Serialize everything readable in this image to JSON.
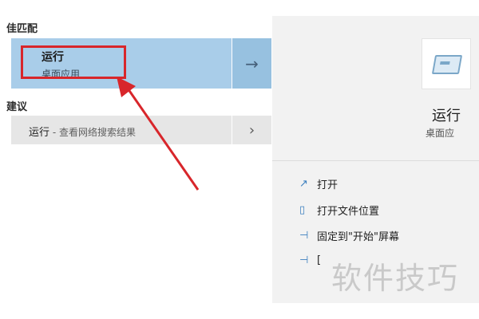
{
  "left": {
    "best_match_header": "佳匹配",
    "best_match": {
      "name": "运行",
      "type": "桌面应用",
      "open_arrow": "→"
    },
    "suggestions_header": "建议",
    "suggestion": {
      "text": "运行",
      "suffix": " - 查看网络搜索结果",
      "arrow": "›"
    }
  },
  "right": {
    "app_title": "运行",
    "app_subtitle": "桌面应",
    "actions": [
      {
        "label": "打开",
        "icon": "open-icon"
      },
      {
        "label": "打开文件位置",
        "icon": "file-location-icon"
      },
      {
        "label": "固定到\"开始\"屏幕",
        "icon": "pin-icon"
      },
      {
        "label": "[",
        "icon": "pin-taskbar-icon"
      }
    ]
  },
  "annotation": {
    "highlight_color": "#d8262b"
  },
  "watermark": "软件技巧"
}
